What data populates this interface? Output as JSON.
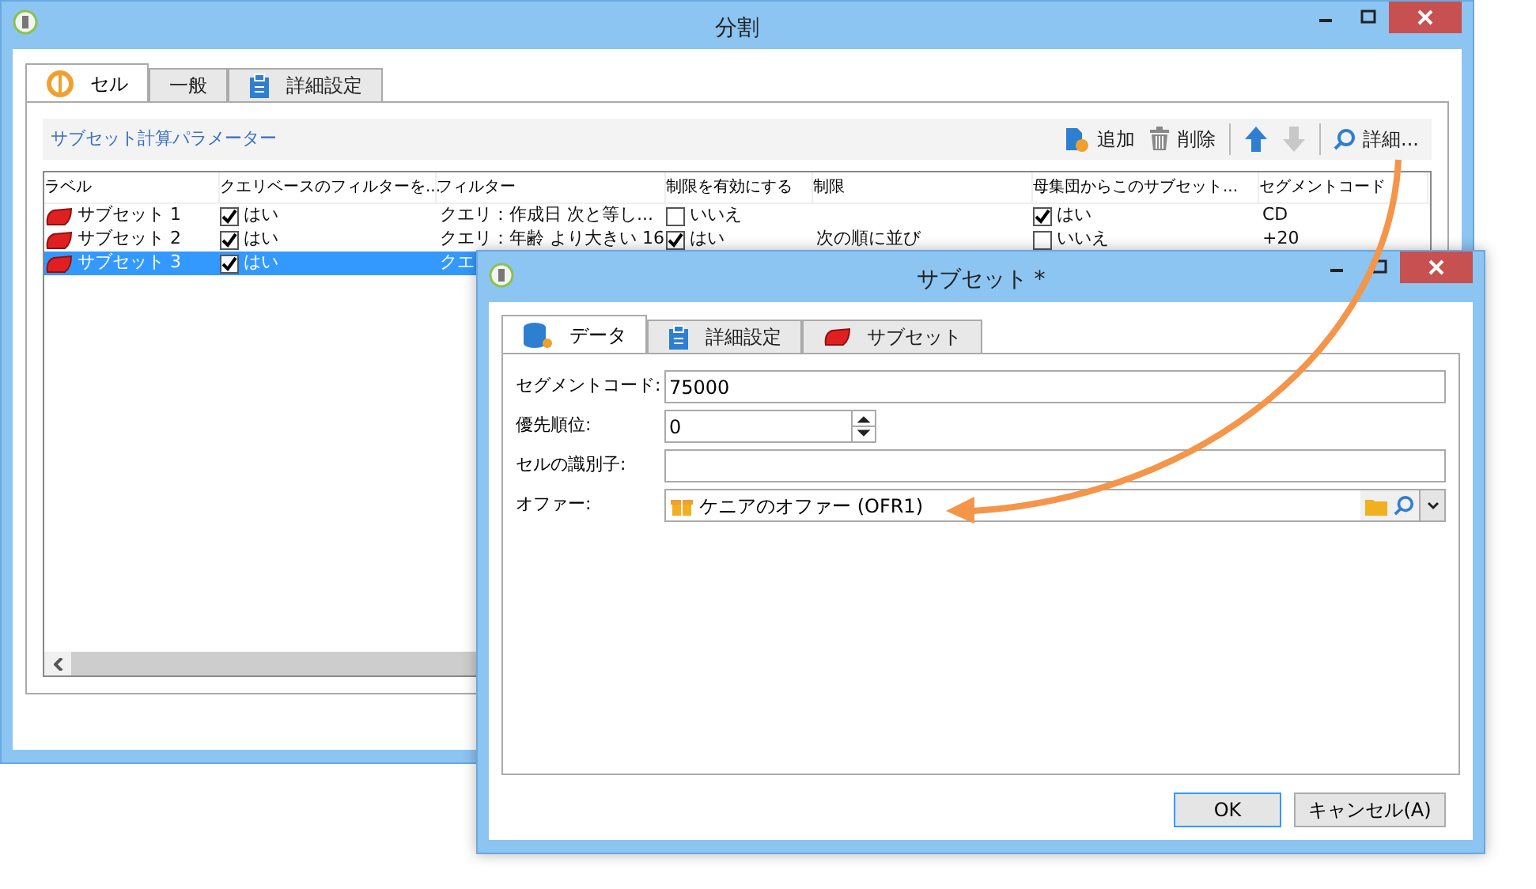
{
  "main_window": {
    "title": "分割",
    "tabs": [
      {
        "label": "セル",
        "kind": "cell",
        "selected": true
      },
      {
        "label": "一般",
        "kind": "plain",
        "selected": false
      },
      {
        "label": "詳細設定",
        "kind": "clipboard",
        "selected": false
      }
    ],
    "section_title": "サブセット計算パラメーター",
    "toolbar": [
      {
        "kind": "add",
        "label": "追加",
        "disabled": false
      },
      {
        "kind": "delete",
        "label": "削除",
        "disabled": false
      },
      {
        "kind": "up",
        "disabled": false
      },
      {
        "kind": "down",
        "disabled": true
      },
      {
        "kind": "details",
        "label": "詳細..."
      }
    ],
    "table": {
      "columns": [
        "ラベル",
        "クエリベースのフィルターを...",
        "フィルター",
        "制限を有効にする",
        "制限",
        "母集団からこのサブセット...",
        "セグメントコード"
      ],
      "rows": [
        {
          "selected": false,
          "cells": [
            {
              "kind": "label",
              "text": "サブセット 1"
            },
            {
              "kind": "check",
              "checked": true,
              "text": "はい"
            },
            {
              "kind": "text",
              "text": "クエリ：作成日 次と等し..."
            },
            {
              "kind": "check",
              "checked": false,
              "text": "いいえ"
            },
            {
              "kind": "text",
              "text": ""
            },
            {
              "kind": "check",
              "checked": true,
              "text": "はい"
            },
            {
              "kind": "text",
              "text": "CD"
            }
          ]
        },
        {
          "selected": false,
          "cells": [
            {
              "kind": "label",
              "text": "サブセット 2"
            },
            {
              "kind": "check",
              "checked": true,
              "text": "はい"
            },
            {
              "kind": "text",
              "text": "クエリ：年齢 より大きい 16"
            },
            {
              "kind": "check",
              "checked": true,
              "text": "はい"
            },
            {
              "kind": "text",
              "text": "次の順に並び"
            },
            {
              "kind": "check",
              "checked": false,
              "text": "いいえ"
            },
            {
              "kind": "text",
              "text": "+20"
            }
          ]
        },
        {
          "selected": true,
          "cells": [
            {
              "kind": "label",
              "text": "サブセット 3"
            },
            {
              "kind": "check",
              "checked": true,
              "text": "はい"
            },
            {
              "kind": "text",
              "text": "クエ"
            }
          ]
        }
      ]
    }
  },
  "subset_window": {
    "title": "サブセット *",
    "tabs": [
      {
        "label": "データ",
        "kind": "database",
        "selected": true
      },
      {
        "label": "詳細設定",
        "kind": "clipboard",
        "selected": false
      },
      {
        "label": "サブセット",
        "kind": "subset",
        "selected": false
      }
    ],
    "fields": [
      {
        "kind": "text",
        "label": "セグメントコード:",
        "value": "75000"
      },
      {
        "kind": "spinner",
        "label": "優先順位:",
        "value": "0"
      },
      {
        "kind": "text",
        "label": "セルの識別子:"
      },
      {
        "kind": "lookup",
        "label": "オファー:",
        "value": "ケニアのオファー (OFR1)"
      }
    ],
    "buttons": [
      {
        "label": "OK",
        "default": true
      },
      {
        "label": "キャンセル(A)",
        "default": false
      }
    ]
  }
}
